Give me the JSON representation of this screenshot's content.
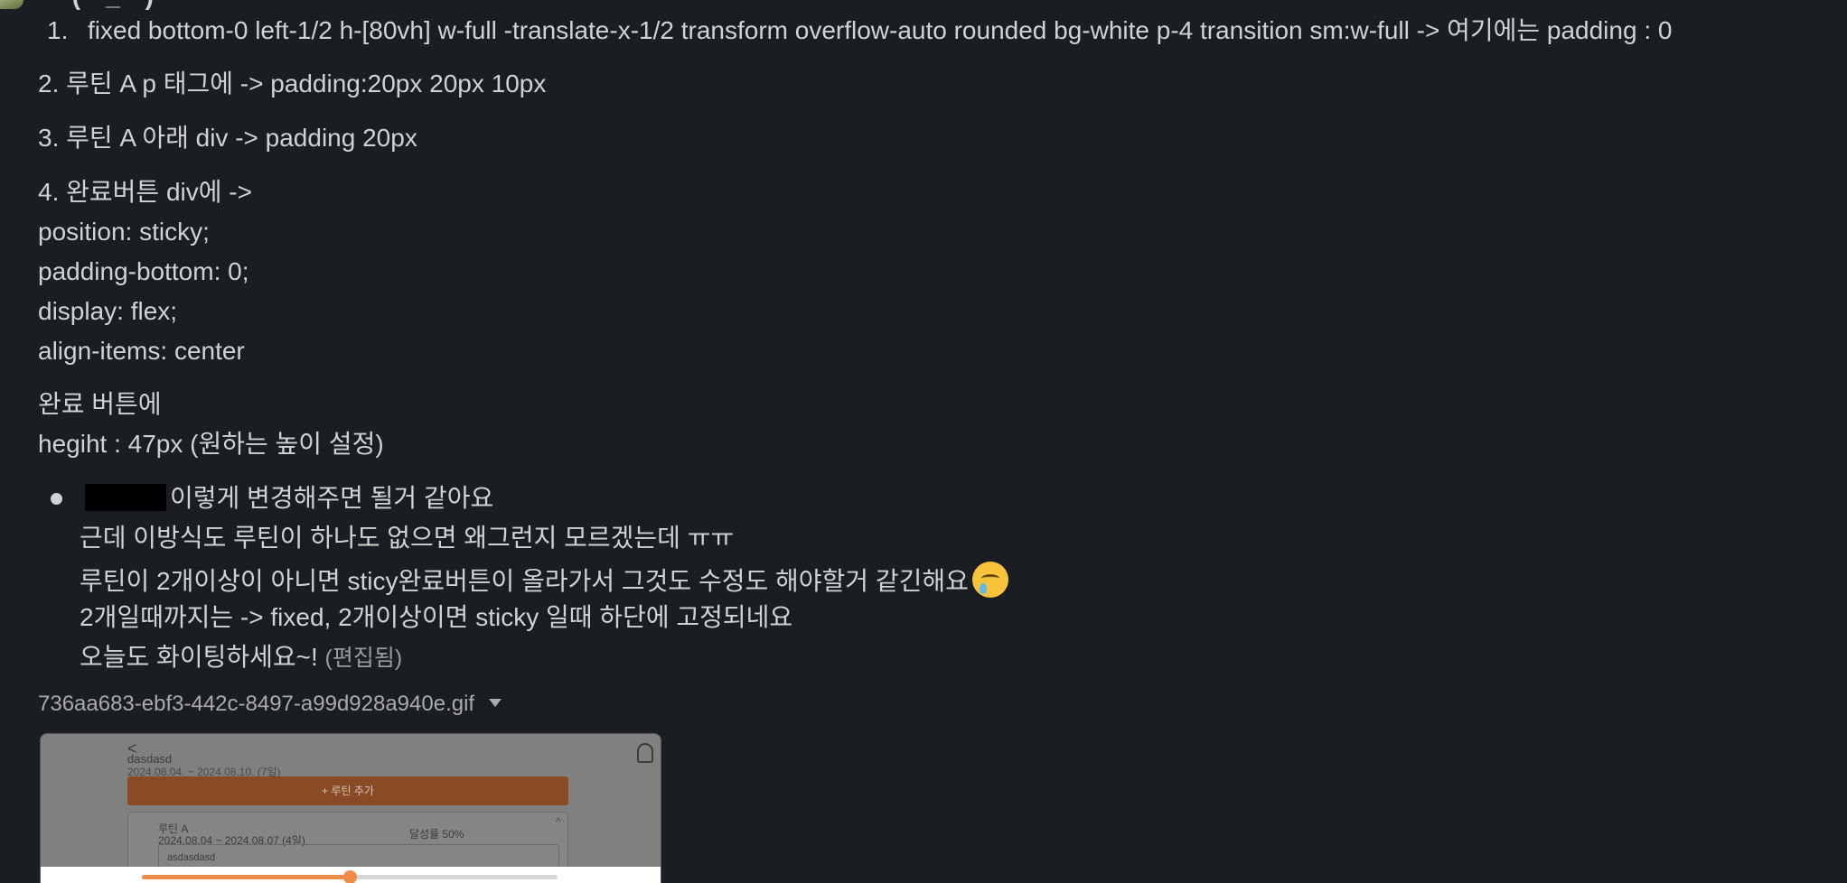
{
  "message": {
    "author_partial": "— (—_—) —",
    "list_marker": "1.",
    "lines": {
      "l1": "fixed bottom-0 left-1/2 h-[80vh] w-full -translate-x-1/2 transform overflow-auto rounded bg-white p-4 transition sm:w-full -> 여기에는 padding : 0",
      "l2": "2. 루틴 A p 태그에  -> padding:20px 20px 10px",
      "l3": "3. 루틴 A 아래 div  ->  padding 20px",
      "l4": "4. 완료버튼 div에  ->",
      "l5": "position: sticky;",
      "l6": "padding-bottom: 0;",
      "l7": "display: flex;",
      "l8": "align-items: center",
      "l9": "완료 버튼에",
      "l10": "hegiht : 47px (원하는 높이 설정)"
    },
    "bullet": {
      "b1": "이렇게 변경해주면 될거 같아요",
      "b2": "근데 이방식도  루틴이 하나도 없으면 왜그런지 모르겠는데 ㅠㅠ",
      "b3": "루틴이 2개이상이 아니면 sticy완료버튼이 올라가서 그것도 수정도 해야할거 같긴해요",
      "b4": "2개일때까지는 -> fixed, 2개이상이면 sticky 일때 하단에 고정되네요",
      "b5": "오늘도 화이팅하세요~!",
      "edited": "(편집됨)"
    },
    "emoji_icon": "crying-face-icon"
  },
  "attachment": {
    "filename": "736aa683-ebf3-442c-8497-a99d928a940e.gif",
    "preview": {
      "back_glyph": "<",
      "title": "dasdasd",
      "date_range": "2024.08.04. ~ 2024.08.10. (7일)",
      "add_button": "+ 루틴 추가",
      "routine_name": "루틴 A",
      "routine_dates": "2024.08.04 ~ 2024.08.07 (4일)",
      "achievement": "달성률 50%",
      "chevron": "^",
      "input_value": "asdasdasd",
      "progress": 0.5
    }
  },
  "colors": {
    "background": "#1a1d21",
    "text": "#d1d2d3",
    "muted": "#ababad",
    "accent_orange": "#f08b4a"
  }
}
